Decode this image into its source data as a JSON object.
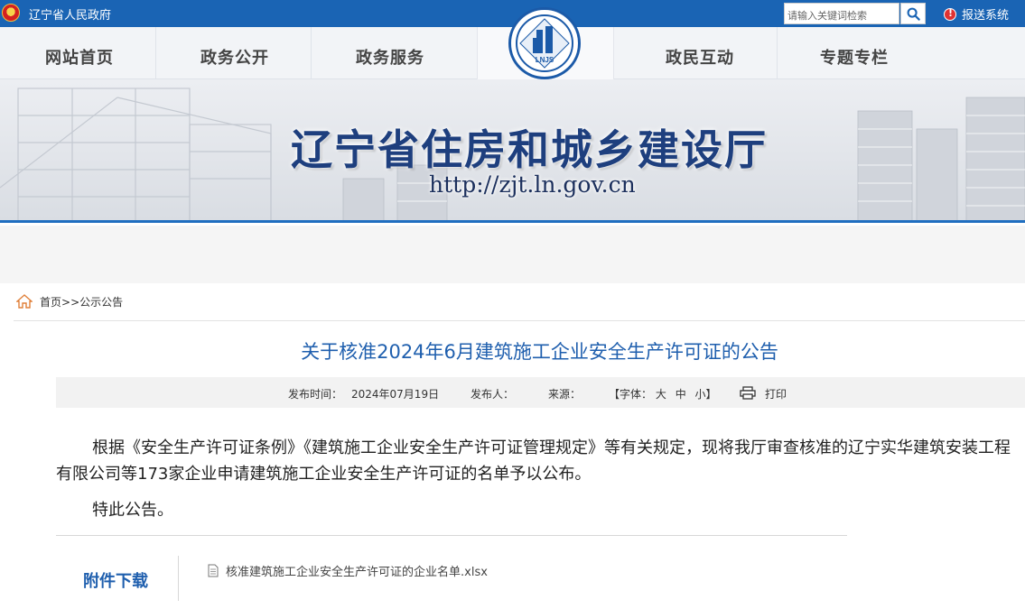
{
  "topbar": {
    "gov_link": "辽宁省人民政府",
    "search_placeholder": "请输入关键词检索",
    "report_label": "报送系统"
  },
  "nav": {
    "items": [
      "网站首页",
      "政务公开",
      "政务服务",
      "政民互动",
      "专题专栏"
    ],
    "logo_text": "LNJS"
  },
  "banner": {
    "title": "辽宁省住房和城乡建设厅",
    "url": "http://zjt.ln.gov.cn"
  },
  "breadcrumb": {
    "home": "首页",
    "separator": ">>",
    "current": "公示公告"
  },
  "article": {
    "title": "关于核准2024年6月建筑施工企业安全生产许可证的公告",
    "meta": {
      "publish_label": "发布时间：",
      "publish_date": "2024年07月19日",
      "publisher_label": "发布人：",
      "source_label": "来源：",
      "font_open": "【字体：",
      "font_large": "大",
      "font_medium": "中",
      "font_small": "小】",
      "print_label": "打印"
    },
    "paragraph_1": "根据《安全生产许可证条例》《建筑施工企业安全生产许可证管理规定》等有关规定，现将我厅审查核准的辽宁实华建筑安装工程有限公司等173家企业申请建筑施工企业安全生产许可证的名单予以公布。",
    "paragraph_2": "特此公告。"
  },
  "attachments": {
    "label": "附件下载",
    "files": [
      "核准建筑施工企业安全生产许可证的企业名单.xlsx"
    ]
  },
  "colors": {
    "topbar_bg": "#1a64b4",
    "title_blue": "#1f5fae",
    "banner_title": "#1e3f7e"
  }
}
